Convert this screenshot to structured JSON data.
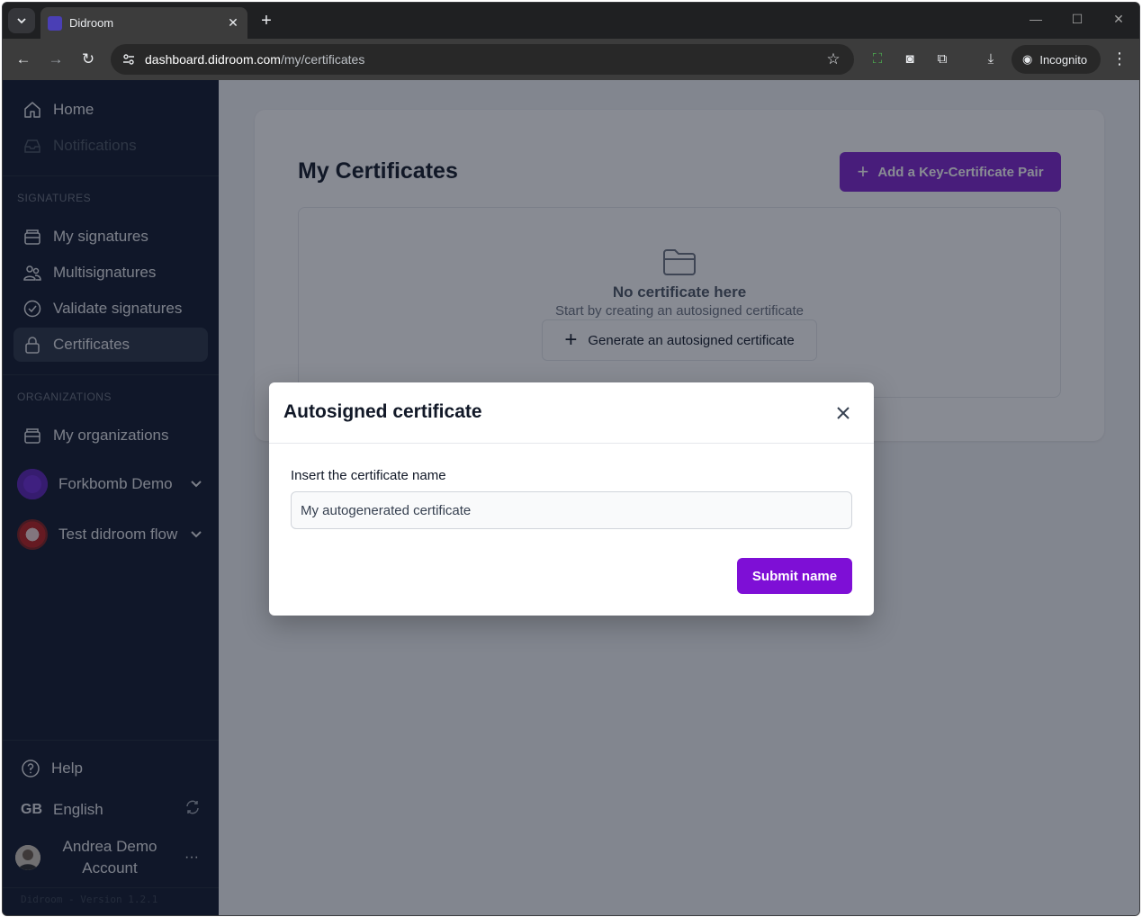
{
  "browser": {
    "tab_title": "Didroom",
    "url_host": "dashboard.didroom.com",
    "url_path": "/my/certificates",
    "incognito_label": "Incognito"
  },
  "sidebar": {
    "top": [
      {
        "label": "Home",
        "icon": "home-icon"
      },
      {
        "label": "Notifications",
        "icon": "inbox-icon"
      }
    ],
    "signatures_label": "SIGNATURES",
    "signatures": [
      {
        "label": "My signatures",
        "icon": "tray-icon"
      },
      {
        "label": "Multisignatures",
        "icon": "users-icon"
      },
      {
        "label": "Validate signatures",
        "icon": "check-circle-icon"
      },
      {
        "label": "Certificates",
        "icon": "lock-icon"
      }
    ],
    "organizations_label": "ORGANIZATIONS",
    "my_organizations": "My organizations",
    "orgs": [
      {
        "label": "Forkbomb Demo"
      },
      {
        "label": "Test didroom flow"
      }
    ],
    "help": "Help",
    "lang_code": "GB",
    "language": "English",
    "user_name": "Andrea Demo Account",
    "version": "Didroom - Version 1.2.1"
  },
  "main": {
    "title": "My Certificates",
    "add_button": "Add a Key-Certificate Pair",
    "empty_title": "No certificate here",
    "empty_subtitle": "Start by creating an autosigned certificate",
    "generate_button": "Generate an autosigned certificate"
  },
  "modal": {
    "title": "Autosigned certificate",
    "field_label": "Insert the certificate name",
    "field_value": "My autogenerated certificate",
    "submit": "Submit name"
  },
  "colors": {
    "sidebar_bg": "#0f172a",
    "accent": "#7e22ce"
  }
}
